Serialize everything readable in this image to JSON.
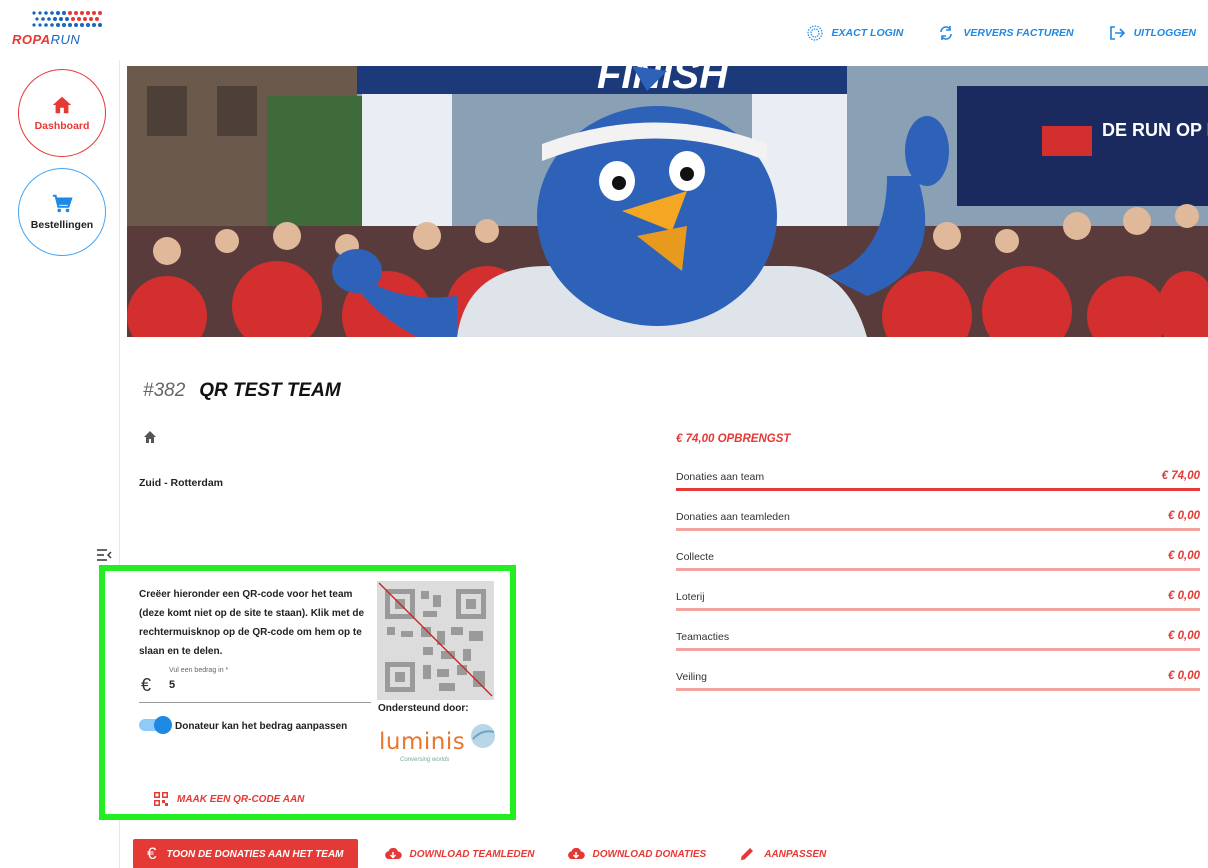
{
  "brand": {
    "name_part1": "ROPA",
    "name_part2": "RUN"
  },
  "topnav": [
    {
      "label": "EXACT LOGIN",
      "icon": "exact-icon"
    },
    {
      "label": "VERVERS FACTUREN",
      "icon": "refresh-icon"
    },
    {
      "label": "UITLOGGEN",
      "icon": "logout-icon"
    }
  ],
  "sidebar": {
    "items": [
      {
        "label": "Dashboard",
        "icon": "home-icon"
      },
      {
        "label": "Bestellingen",
        "icon": "cart-icon"
      }
    ]
  },
  "team": {
    "number": "#382",
    "name": "QR TEST TEAM",
    "location": "Zuid - Rotterdam"
  },
  "revenue": {
    "title": "€ 74,00 OPBRENGST",
    "rows": [
      {
        "label": "Donaties aan team",
        "value": "€ 74,00",
        "fraction": 1.0
      },
      {
        "label": "Donaties aan teamleden",
        "value": "€ 0,00",
        "fraction": 0
      },
      {
        "label": "Collecte",
        "value": "€ 0,00",
        "fraction": 0
      },
      {
        "label": "Loterij",
        "value": "€ 0,00",
        "fraction": 0
      },
      {
        "label": "Teamacties",
        "value": "€ 0,00",
        "fraction": 0
      },
      {
        "label": "Veiling",
        "value": "€ 0,00",
        "fraction": 0
      }
    ]
  },
  "qr": {
    "description": "Creëer hieronder een QR-code voor het team (deze komt niet op de site te staan). Klik met de rechtermuisknop op de QR-code om hem op te slaan en te delen.",
    "amount_label": "Vul een bedrag in *",
    "amount_currency": "€",
    "amount_value": "5",
    "toggle_label": "Donateur kan het bedrag aanpassen",
    "toggle_on": true,
    "supported_by": "Ondersteund door:",
    "sponsor_name": "luminis",
    "sponsor_tagline": "Conversing worlds",
    "make_button": "MAAK EEN QR-CODE AAN"
  },
  "actions": {
    "primary": {
      "label": "TOON DE DONATIES AAN HET TEAM",
      "icon_text": "€"
    },
    "links": [
      {
        "label": "DOWNLOAD TEAMLEDEN",
        "icon": "cloud-download-icon"
      },
      {
        "label": "DOWNLOAD DONATIES",
        "icon": "cloud-download-icon"
      },
      {
        "label": "AANPASSEN",
        "icon": "pencil-icon"
      }
    ]
  },
  "colors": {
    "accent": "#e53935",
    "link_blue": "#1e88e5",
    "highlight_border": "#22ee22"
  }
}
